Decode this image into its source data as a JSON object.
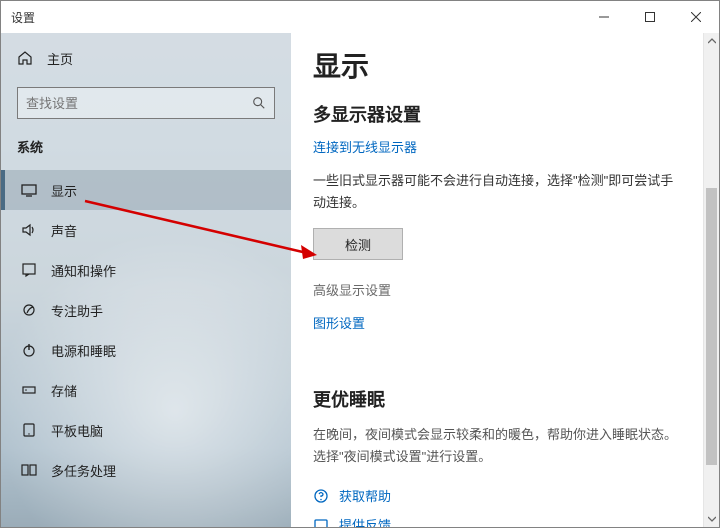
{
  "window": {
    "title": "设置"
  },
  "sidebar": {
    "home": "主页",
    "search_placeholder": "查找设置",
    "section": "系统",
    "items": [
      {
        "label": "显示"
      },
      {
        "label": "声音"
      },
      {
        "label": "通知和操作"
      },
      {
        "label": "专注助手"
      },
      {
        "label": "电源和睡眠"
      },
      {
        "label": "存储"
      },
      {
        "label": "平板电脑"
      },
      {
        "label": "多任务处理"
      }
    ]
  },
  "main": {
    "title": "显示",
    "multi_header": "多显示器设置",
    "connect_wireless": "连接到无线显示器",
    "old_display_desc": "一些旧式显示器可能不会进行自动连接，选择\"检测\"即可尝试手动连接。",
    "detect_btn": "检测",
    "adv_display": "高级显示设置",
    "graphics_settings": "图形设置",
    "sleep_header": "更优睡眠",
    "sleep_desc": "在晚间，夜间模式会显示较柔和的暖色，帮助你进入睡眠状态。选择\"夜间模式设置\"进行设置。",
    "get_help": "获取帮助",
    "give_feedback": "提供反馈"
  }
}
